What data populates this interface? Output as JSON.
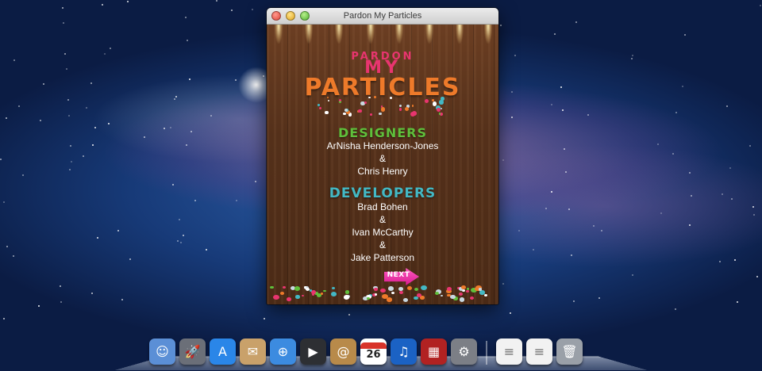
{
  "window": {
    "title": "Pardon My Particles"
  },
  "app": {
    "logo": {
      "line1": "PARDON",
      "line2": "MY",
      "line3": "PARTICLES"
    },
    "designers": {
      "heading": "DESIGNERS",
      "names": [
        "ArNisha Henderson-Jones",
        "&",
        "Chris Henry"
      ]
    },
    "developers": {
      "heading": "DEVELOPERS",
      "names": [
        "Brad Bohen",
        "&",
        "Ivan McCarthy",
        "&",
        "Jake Patterson"
      ]
    },
    "next_label": "NEXT"
  },
  "dock": {
    "items": [
      {
        "icon": "finder-icon",
        "color": "#5b8fd6",
        "glyph": "☺"
      },
      {
        "icon": "launchpad-icon",
        "color": "#6b6f78",
        "glyph": "🚀"
      },
      {
        "icon": "app-store-icon",
        "color": "#2a86e8",
        "glyph": "A"
      },
      {
        "icon": "mail-icon",
        "color": "#c9a16a",
        "glyph": "✉"
      },
      {
        "icon": "safari-icon",
        "color": "#3c8be0",
        "glyph": "⊕"
      },
      {
        "icon": "facetime-icon",
        "color": "#2d2f33",
        "glyph": "▶"
      },
      {
        "icon": "address-book-icon",
        "color": "#b88a4a",
        "glyph": "@"
      },
      {
        "icon": "calendar-icon",
        "color": "#ffffff",
        "glyph": "26"
      },
      {
        "icon": "itunes-icon",
        "color": "#1b62c4",
        "glyph": "♫"
      },
      {
        "icon": "photo-booth-icon",
        "color": "#b12222",
        "glyph": "▦"
      },
      {
        "icon": "system-preferences-icon",
        "color": "#7c7f86",
        "glyph": "⚙"
      },
      {
        "icon": "document-icon",
        "color": "#f2f2f2",
        "glyph": "≡"
      },
      {
        "icon": "document-icon",
        "color": "#f2f2f2",
        "glyph": "≡"
      },
      {
        "icon": "trash-icon",
        "color": "#9aa0a8",
        "glyph": "🗑"
      }
    ]
  }
}
